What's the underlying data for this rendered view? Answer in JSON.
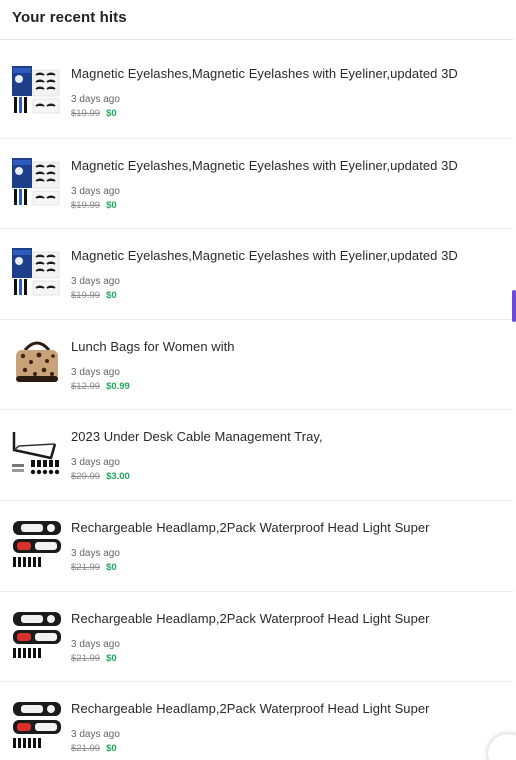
{
  "header": {
    "title": "Your recent hits"
  },
  "items": [
    {
      "title": "Magnetic Eyelashes,Magnetic Eyelashes with Eyeliner,updated 3D",
      "time": "3 days ago",
      "old_price": "$19.99",
      "new_price": "$0",
      "thumb": "eyelashes-kit-image"
    },
    {
      "title": "Magnetic Eyelashes,Magnetic Eyelashes with Eyeliner,updated 3D",
      "time": "3 days ago",
      "old_price": "$19.99",
      "new_price": "$0",
      "thumb": "eyelashes-kit-image"
    },
    {
      "title": "Magnetic Eyelashes,Magnetic Eyelashes with Eyeliner,updated 3D",
      "time": "3 days ago",
      "old_price": "$19.99",
      "new_price": "$0",
      "thumb": "eyelashes-kit-image"
    },
    {
      "title": "Lunch Bags for Women with",
      "time": "3 days ago",
      "old_price": "$12.99",
      "new_price": "$0.99",
      "thumb": "leopard-lunch-bag-image"
    },
    {
      "title": "2023 Under Desk Cable Management Tray,",
      "time": "3 days ago",
      "old_price": "$29.99",
      "new_price": "$3.00",
      "thumb": "cable-tray-image"
    },
    {
      "title": "Rechargeable Headlamp,2Pack Waterproof Head Light Super",
      "time": "3 days ago",
      "old_price": "$21.99",
      "new_price": "$0",
      "thumb": "headlamp-image"
    },
    {
      "title": "Rechargeable Headlamp,2Pack Waterproof Head Light Super",
      "time": "3 days ago",
      "old_price": "$21.99",
      "new_price": "$0",
      "thumb": "headlamp-image"
    },
    {
      "title": "Rechargeable Headlamp,2Pack Waterproof Head Light Super",
      "time": "3 days ago",
      "old_price": "$21.99",
      "new_price": "$0",
      "thumb": "headlamp-image"
    }
  ],
  "colors": {
    "accent": "#6a4bd8",
    "price_new": "#1faa59",
    "price_old": "#8a8a8a"
  }
}
